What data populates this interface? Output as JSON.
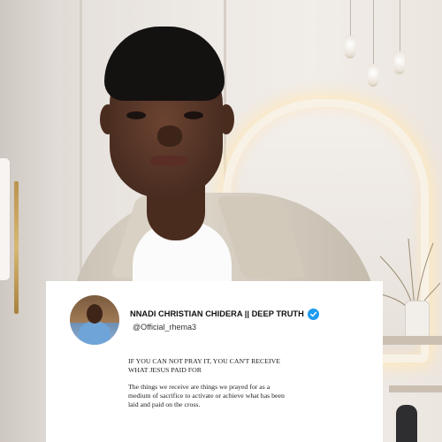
{
  "post": {
    "display_name": "NNADI CHRISTIAN CHIDERA || DEEP TRUTH",
    "handle": "@Official_rhema3",
    "verified": true,
    "paragraph_1": "IF YOU CAN NOT PRAY IT, YOU CAN'T RECEIVE WHAT JESUS PAID FOR",
    "paragraph_2": "The things we receive are things we prayed for as a medium of sacrifice to activate or achieve what has been laid and paid on the cross."
  },
  "colors": {
    "verified_badge": "#1d9bf0",
    "card_background": "#ffffff"
  },
  "icons": {
    "verified": "verified-badge-icon"
  }
}
